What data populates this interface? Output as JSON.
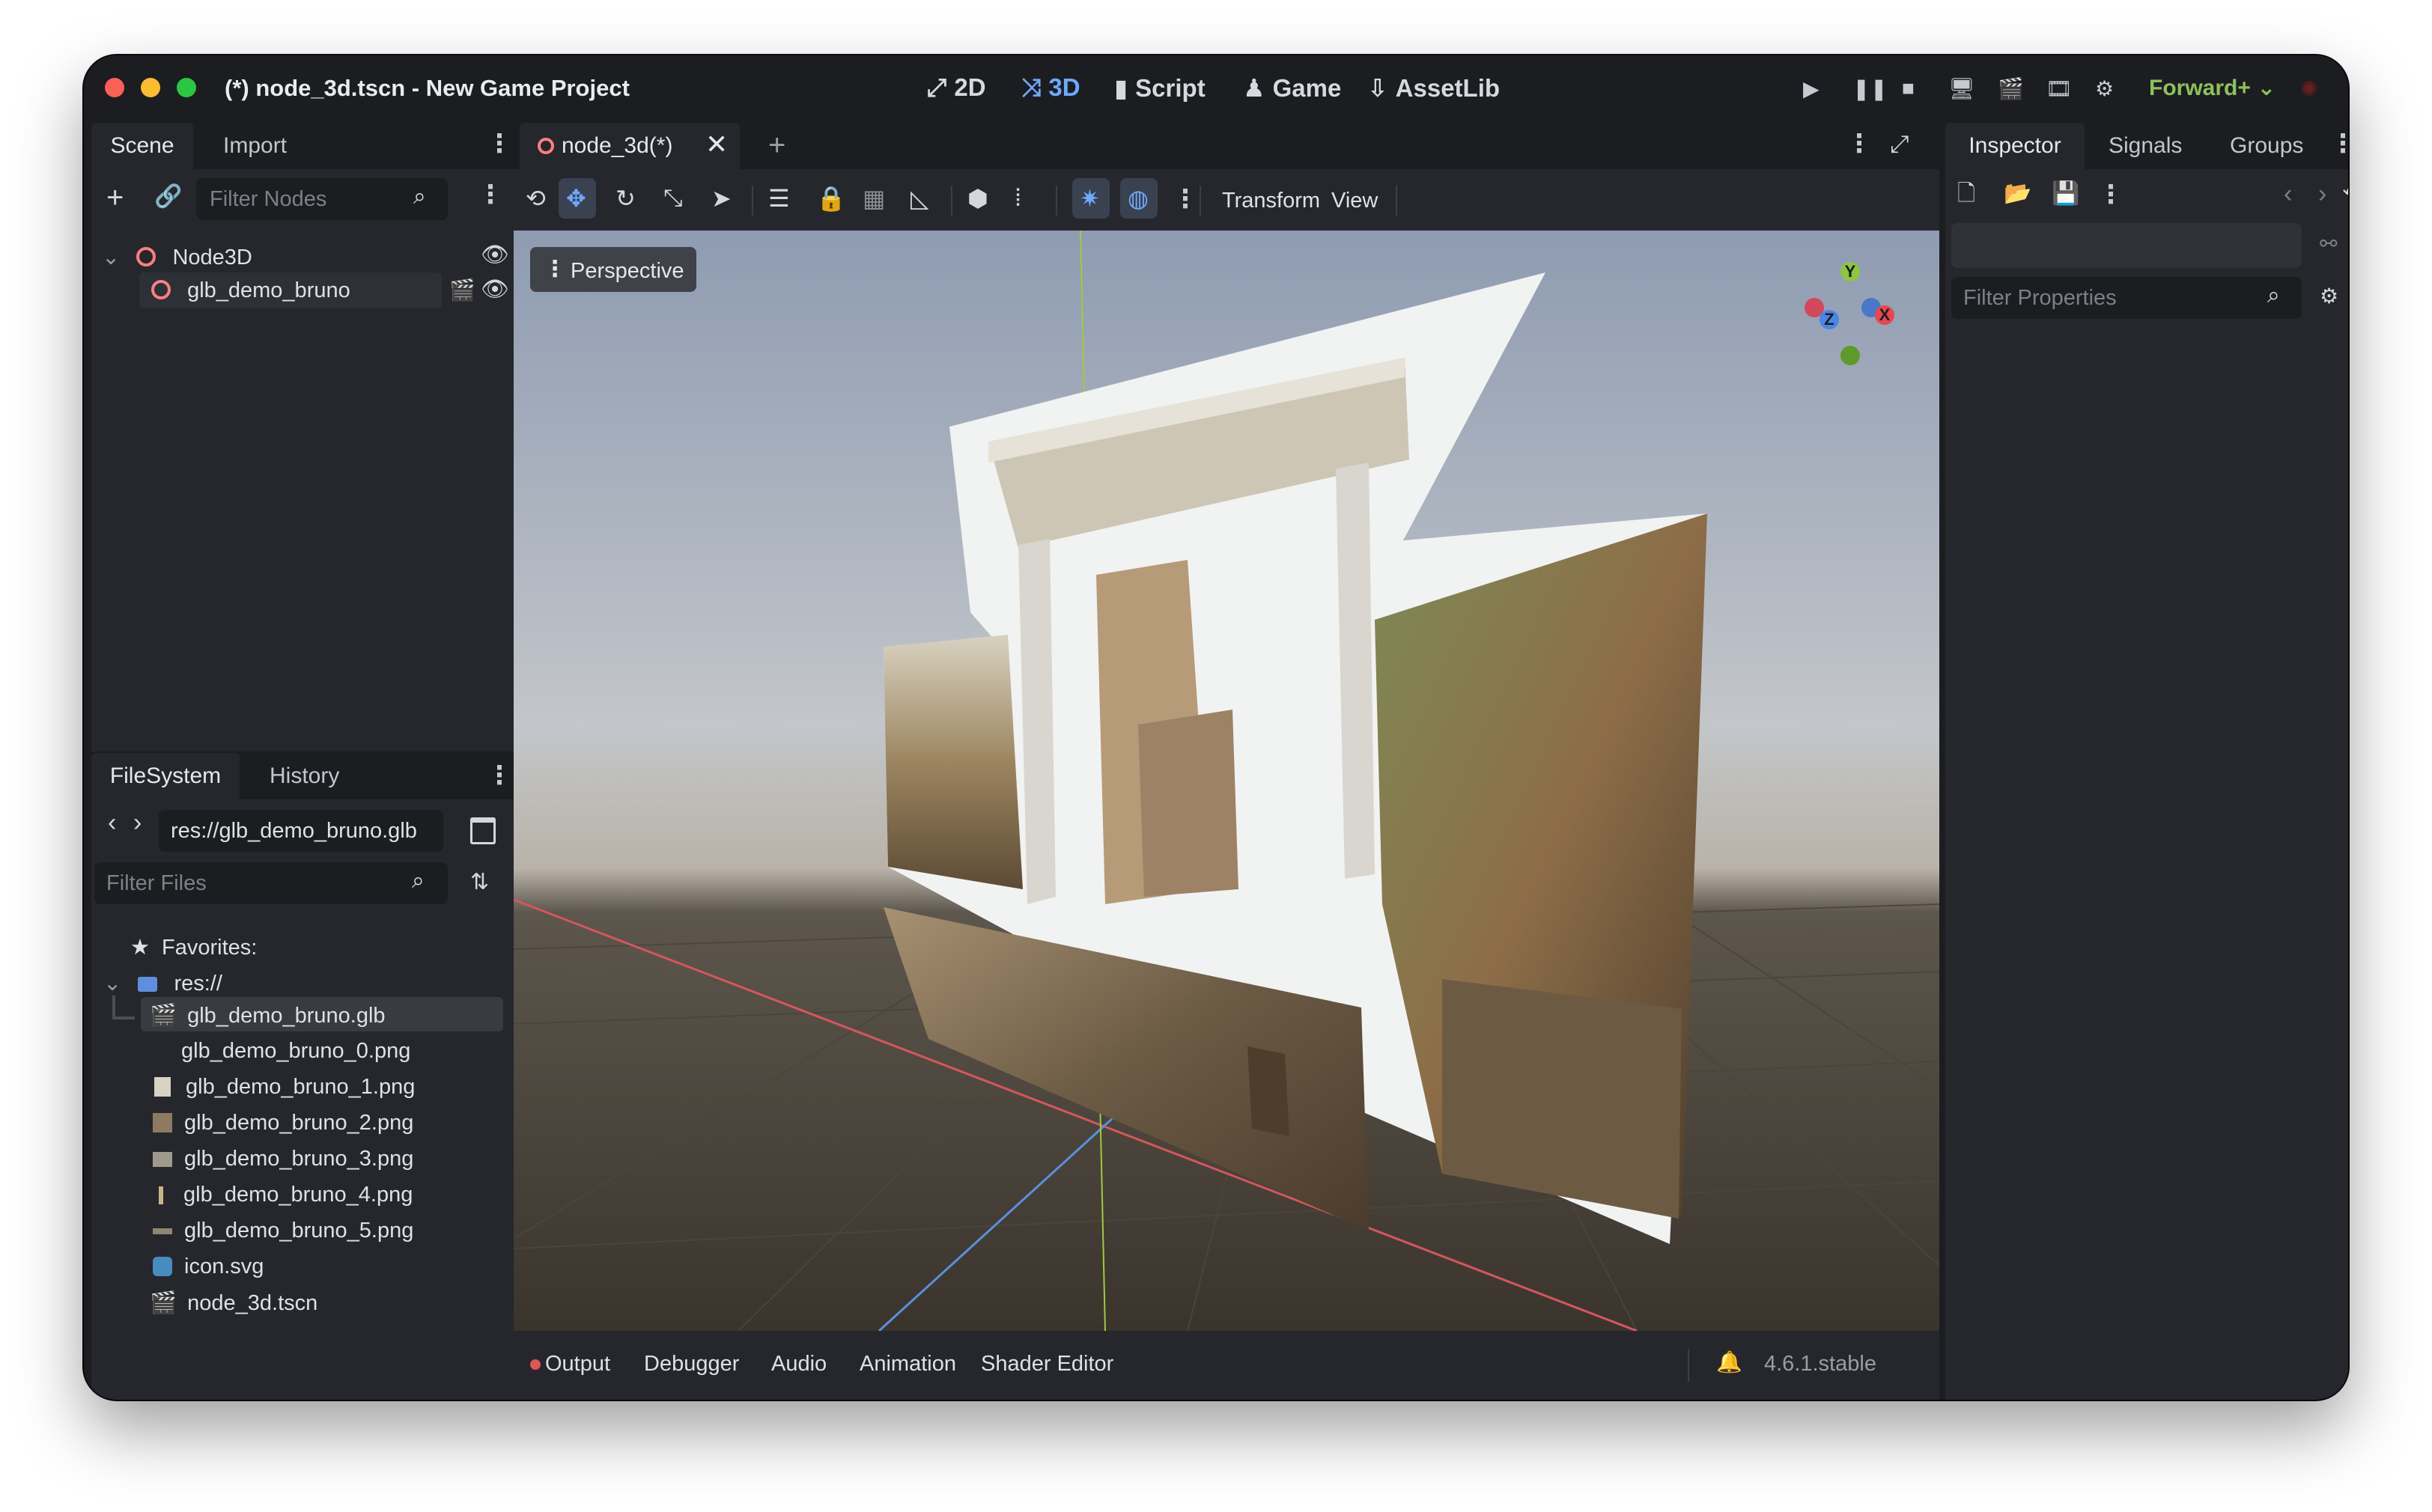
{
  "window": {
    "title": "(*) node_3d.tscn - New Game Project"
  },
  "modes": [
    {
      "icon": "⤢",
      "label": "2D"
    },
    {
      "icon": "⤨",
      "label": "3D"
    },
    {
      "icon": "▮",
      "label": "Script"
    },
    {
      "icon": "♟",
      "label": "Game"
    },
    {
      "icon": "⇩",
      "label": "AssetLib"
    }
  ],
  "renderer": "Forward+",
  "scene_dock": {
    "tabs": [
      "Scene",
      "Import"
    ],
    "filter_placeholder": "Filter Nodes",
    "nodes": [
      {
        "label": "Node3D"
      },
      {
        "label": "glb_demo_bruno"
      }
    ]
  },
  "filesystem_dock": {
    "tabs": [
      "FileSystem",
      "History"
    ],
    "path": "res://glb_demo_bruno.glb",
    "filter_placeholder": "Filter Files",
    "favorites": "Favorites:",
    "root": "res://",
    "files": [
      "glb_demo_bruno.glb",
      "glb_demo_bruno_0.png",
      "glb_demo_bruno_1.png",
      "glb_demo_bruno_2.png",
      "glb_demo_bruno_3.png",
      "glb_demo_bruno_4.png",
      "glb_demo_bruno_5.png",
      "icon.svg",
      "node_3d.tscn"
    ]
  },
  "editor": {
    "scene_tab": "node_3d(*)",
    "menus": [
      "Transform",
      "View"
    ],
    "viewport_label": "Perspective",
    "gizmo": {
      "y": "Y",
      "z": "Z",
      "x": "X"
    }
  },
  "bottom_panel": {
    "tabs": [
      "Output",
      "Debugger",
      "Audio",
      "Animation",
      "Shader Editor"
    ],
    "version": "4.6.1.stable"
  },
  "inspector": {
    "tabs": [
      "Inspector",
      "Signals",
      "Groups"
    ],
    "filter_placeholder": "Filter Properties"
  },
  "colors": {
    "accent": "#6fa9ff",
    "node_icon": "#fc7f7f",
    "renderer": "#8dc258",
    "output_dot": "#e05555"
  }
}
